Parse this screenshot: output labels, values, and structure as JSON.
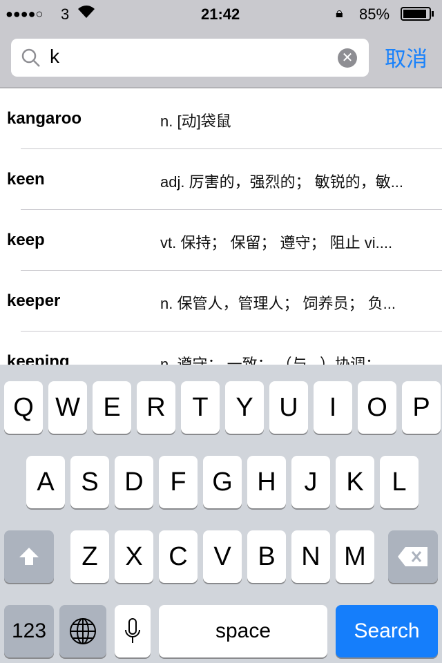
{
  "status": {
    "signal": "●●●●○",
    "carrier": "3",
    "time": "21:42",
    "battery": "85%"
  },
  "search": {
    "query": "k",
    "cancel": "取消"
  },
  "results": [
    {
      "word": "kangaroo",
      "definition": "n. [动]袋鼠"
    },
    {
      "word": "keen",
      "definition": "adj. 厉害的，强烈的； 敏锐的，敏..."
    },
    {
      "word": "keep",
      "definition": "vt. 保持； 保留； 遵守； 阻止 vi...."
    },
    {
      "word": "keeper",
      "definition": "n. 保管人，管理人； 饲养员； 负..."
    },
    {
      "word": "keeping",
      "definition": "n. 遵守； 一致； （与...）协调；"
    }
  ],
  "keyboard": {
    "row1": [
      "Q",
      "W",
      "E",
      "R",
      "T",
      "Y",
      "U",
      "I",
      "O",
      "P"
    ],
    "row2": [
      "A",
      "S",
      "D",
      "F",
      "G",
      "H",
      "J",
      "K",
      "L"
    ],
    "row3": [
      "Z",
      "X",
      "C",
      "V",
      "B",
      "N",
      "M"
    ],
    "numbers": "123",
    "space": "space",
    "search": "Search"
  },
  "colors": {
    "accent": "#157efb",
    "cancel": "#1a82fb"
  }
}
